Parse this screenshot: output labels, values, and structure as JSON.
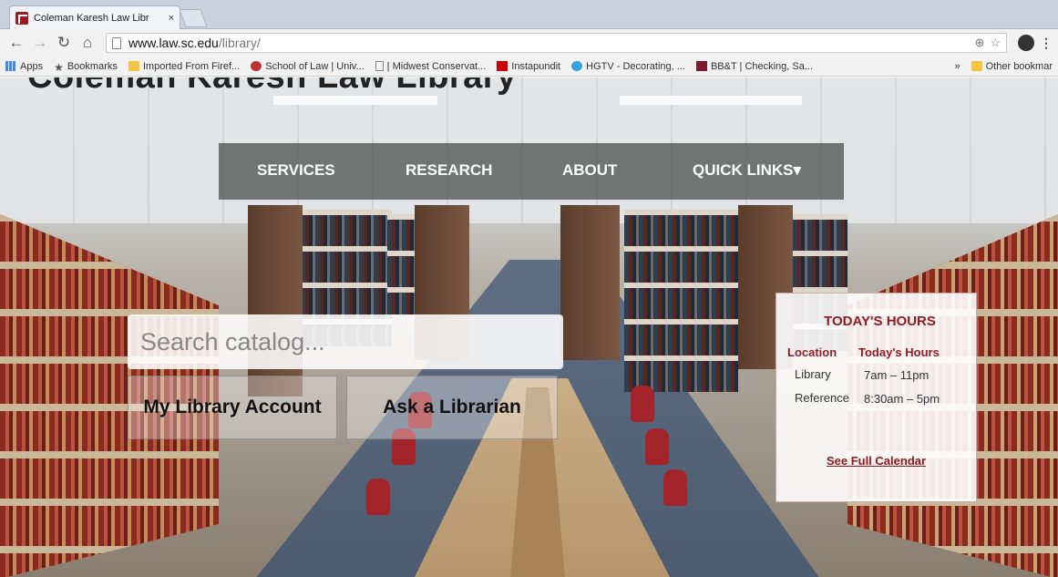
{
  "browser": {
    "tab": {
      "title": "Coleman Karesh Law Libr",
      "close": "×"
    },
    "url": {
      "host": "www.law.sc.edu",
      "path": "/library/"
    },
    "bookmarks": [
      {
        "label": "Apps",
        "icon": "apps-grid-icon"
      },
      {
        "label": "Bookmarks",
        "icon": "star-icon"
      },
      {
        "label": "Imported From Firef...",
        "icon": "folder-icon"
      },
      {
        "label": "School of Law | Univ...",
        "icon": "school-seal-icon"
      },
      {
        "label": "| Midwest Conservat...",
        "icon": "page-icon"
      },
      {
        "label": "Instapundit",
        "icon": "instapundit-icon"
      },
      {
        "label": "HGTV - Decorating, ...",
        "icon": "hgtv-icon"
      },
      {
        "label": "BB&T | Checking, Sa...",
        "icon": "bbt-icon"
      }
    ],
    "bookmarks_overflow": "»",
    "other_bookmarks": "Other bookmar"
  },
  "site": {
    "title": "Coleman Karesh Law Library",
    "nav": {
      "services": "SERVICES",
      "research": "RESEARCH",
      "about": "ABOUT",
      "quick_links": "QUICK LINKS▾"
    },
    "search": {
      "placeholder": "Search catalog..."
    },
    "buttons": {
      "account": "My Library Account",
      "librarian": "Ask a Librarian"
    },
    "hours": {
      "title": "TODAY'S HOURS",
      "col_location": "Location",
      "col_hours": "Today's Hours",
      "rows": [
        {
          "location": "Library",
          "hours": "7am – 11pm"
        },
        {
          "location": "Reference",
          "hours": "8:30am – 5pm"
        }
      ],
      "link": "See Full Calendar"
    }
  },
  "colors": {
    "brand": "#8f1d23",
    "nav_overlay": "#464646"
  }
}
